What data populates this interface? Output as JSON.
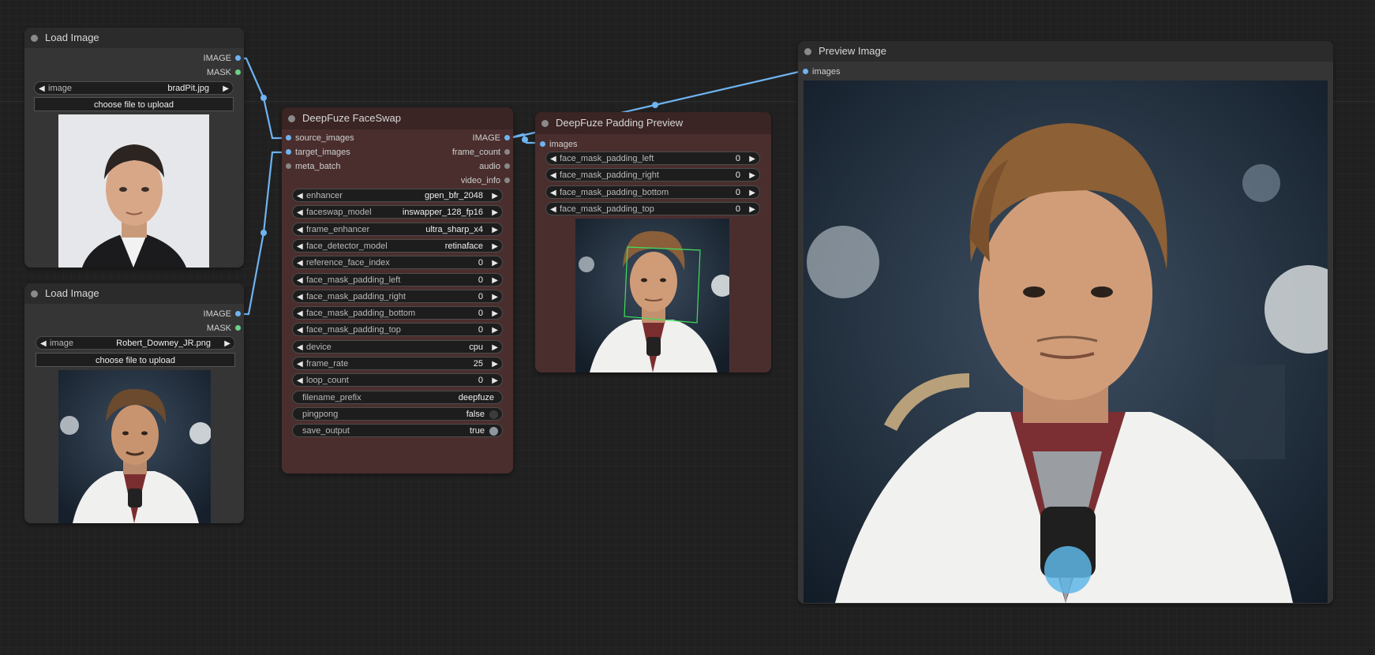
{
  "nodes": {
    "load1": {
      "title": "Load Image",
      "outputs": [
        "IMAGE",
        "MASK"
      ],
      "image_label": "image",
      "image_value": "bradPit.jpg",
      "upload_label": "choose file to upload"
    },
    "load2": {
      "title": "Load Image",
      "outputs": [
        "IMAGE",
        "MASK"
      ],
      "image_label": "image",
      "image_value": "Robert_Downey_JR.png",
      "upload_label": "choose file to upload"
    },
    "faceswap": {
      "title": "DeepFuze FaceSwap",
      "inputs": [
        "source_images",
        "target_images",
        "meta_batch"
      ],
      "outputs": [
        "IMAGE",
        "frame_count",
        "audio",
        "video_info"
      ],
      "widgets": [
        {
          "label": "enhancer",
          "value": "gpen_bfr_2048"
        },
        {
          "label": "faceswap_model",
          "value": "inswapper_128_fp16"
        },
        {
          "label": "frame_enhancer",
          "value": "ultra_sharp_x4"
        },
        {
          "label": "face_detector_model",
          "value": "retinaface"
        },
        {
          "label": "reference_face_index",
          "value": "0"
        },
        {
          "label": "face_mask_padding_left",
          "value": "0"
        },
        {
          "label": "face_mask_padding_right",
          "value": "0"
        },
        {
          "label": "face_mask_padding_bottom",
          "value": "0"
        },
        {
          "label": "face_mask_padding_top",
          "value": "0"
        },
        {
          "label": "device",
          "value": "cpu"
        },
        {
          "label": "frame_rate",
          "value": "25"
        },
        {
          "label": "loop_count",
          "value": "0"
        }
      ],
      "text_widget": {
        "label": "filename_prefix",
        "value": "deepfuze"
      },
      "toggles": [
        {
          "label": "pingpong",
          "value": "false",
          "on": false
        },
        {
          "label": "save_output",
          "value": "true",
          "on": true
        }
      ]
    },
    "padding": {
      "title": "DeepFuze Padding Preview",
      "inputs": [
        "images"
      ],
      "widgets": [
        {
          "label": "face_mask_padding_left",
          "value": "0"
        },
        {
          "label": "face_mask_padding_right",
          "value": "0"
        },
        {
          "label": "face_mask_padding_bottom",
          "value": "0"
        },
        {
          "label": "face_mask_padding_top",
          "value": "0"
        }
      ]
    },
    "preview": {
      "title": "Preview Image",
      "inputs": [
        "images"
      ]
    }
  },
  "colors": {
    "wire": "#6fb3f0",
    "image_slot": "#6fb3f0",
    "mask_slot": "#6ad087"
  }
}
